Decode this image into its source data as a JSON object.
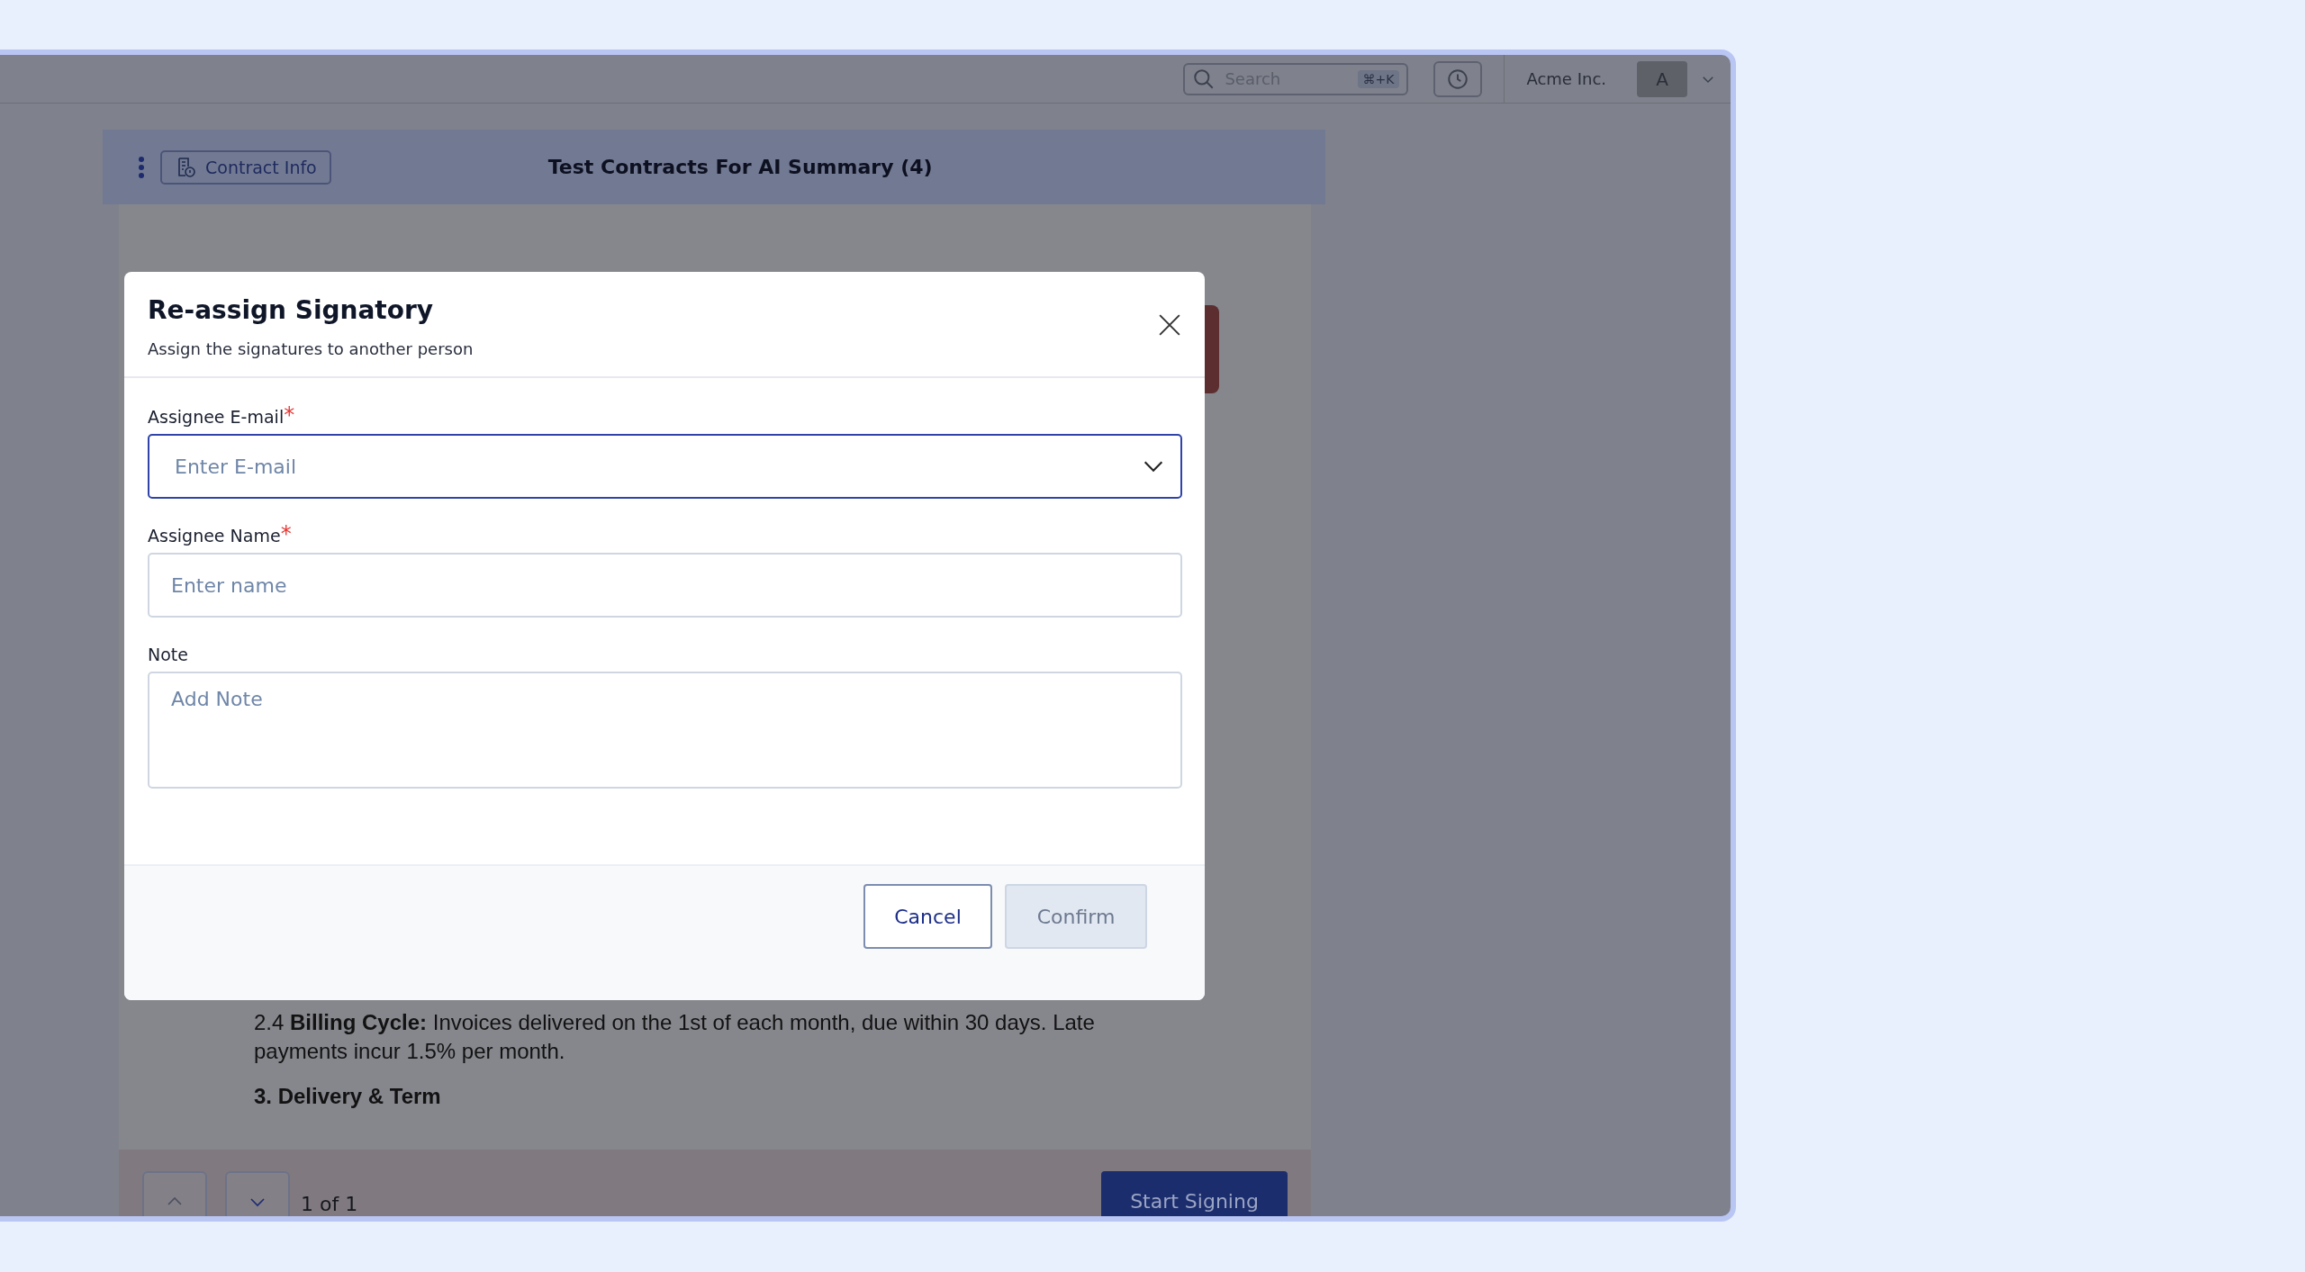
{
  "top_bar": {
    "search": {
      "placeholder": "Search",
      "shortcut": "⌘+K"
    },
    "org_name": "Acme Inc.",
    "avatar_initial": "A"
  },
  "document_header": {
    "info_button": "Contract Info",
    "title": "Test Contracts For AI Summary (4)"
  },
  "document_body": [
    {
      "kind": "paragraph",
      "text": " 2.4 **Billing Cycle:** Invoices delivered on the 1st of each month, due within 30 days. Late payments incur 1.5% per month."
    },
    {
      "kind": "heading",
      "text": "3. Delivery & Term"
    }
  ],
  "pager": {
    "position": "1 of 1",
    "primary_button": "Start Signing"
  },
  "modal": {
    "title": "Re-assign Signatory",
    "subtitle": "Assign the signatures to another person",
    "fields": [
      {
        "kind": "select",
        "label": "Assignee E-mail",
        "required_mark": "*",
        "placeholder": "Enter E-mail",
        "focused": true
      },
      {
        "kind": "text",
        "label": "Assignee Name",
        "required_mark": "*",
        "placeholder": "Enter name",
        "focused": false
      },
      {
        "kind": "textarea",
        "label": "Note",
        "placeholder": "Add Note",
        "focused": false
      }
    ],
    "buttons": [
      {
        "label": "Cancel",
        "kind": "secondary",
        "disabled": false
      },
      {
        "label": "Confirm",
        "kind": "primary",
        "disabled": true
      }
    ]
  }
}
